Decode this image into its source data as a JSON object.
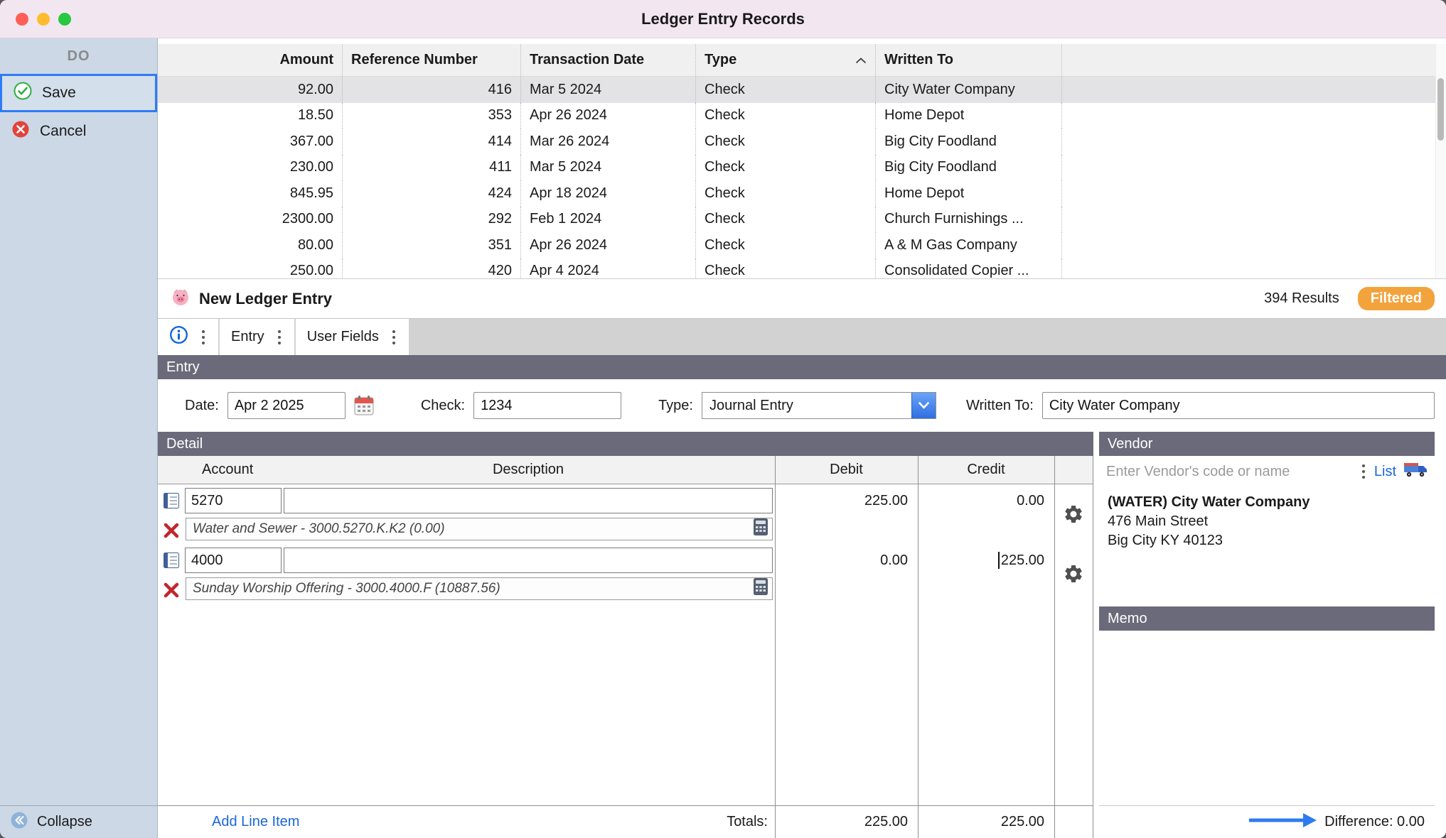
{
  "window": {
    "title": "Ledger Entry Records"
  },
  "sidebar": {
    "header": "DO",
    "save_label": "Save",
    "cancel_label": "Cancel",
    "collapse_label": "Collapse"
  },
  "records": {
    "columns": [
      "Amount",
      "Reference Number",
      "Transaction Date",
      "Type",
      "Written To"
    ],
    "sorted_by": "Type",
    "rows": [
      {
        "amount": "92.00",
        "reference": "416",
        "date": "Mar 5 2024",
        "type": "Check",
        "written_to": "City Water Company"
      },
      {
        "amount": "18.50",
        "reference": "353",
        "date": "Apr 26 2024",
        "type": "Check",
        "written_to": "Home Depot"
      },
      {
        "amount": "367.00",
        "reference": "414",
        "date": "Mar 26 2024",
        "type": "Check",
        "written_to": "Big City Foodland"
      },
      {
        "amount": "230.00",
        "reference": "411",
        "date": "Mar 5 2024",
        "type": "Check",
        "written_to": "Big City Foodland"
      },
      {
        "amount": "845.95",
        "reference": "424",
        "date": "Apr 18 2024",
        "type": "Check",
        "written_to": "Home Depot"
      },
      {
        "amount": "2300.00",
        "reference": "292",
        "date": "Feb 1 2024",
        "type": "Check",
        "written_to": "Church Furnishings ..."
      },
      {
        "amount": "80.00",
        "reference": "351",
        "date": "Apr 26 2024",
        "type": "Check",
        "written_to": "A & M Gas Company"
      },
      {
        "amount": "250.00",
        "reference": "420",
        "date": "Apr 4 2024",
        "type": "Check",
        "written_to": "Consolidated Copier ..."
      }
    ]
  },
  "entry_bar": {
    "title": "New Ledger Entry",
    "results": "394 Results",
    "filtered_label": "Filtered"
  },
  "tabs": {
    "entry": "Entry",
    "user_fields": "User Fields"
  },
  "entry": {
    "section_header": "Entry",
    "date_label": "Date:",
    "date_value": "Apr 2 2025",
    "check_label": "Check:",
    "check_value": "1234",
    "type_label": "Type:",
    "type_value": "Journal Entry",
    "written_to_label": "Written To:",
    "written_to_value": "City Water Company"
  },
  "detail": {
    "section_header": "Detail",
    "columns": [
      "Account",
      "Description",
      "Debit",
      "Credit"
    ],
    "lines": [
      {
        "account": "5270",
        "description": "",
        "debit": "225.00",
        "credit": "0.00",
        "account_info": "Water and Sewer - 3000.5270.K.K2 (0.00)"
      },
      {
        "account": "4000",
        "description": "",
        "debit": "0.00",
        "credit": "225.00",
        "account_info": "Sunday Worship Offering - 3000.4000.F (10887.56)"
      }
    ],
    "add_line_label": "Add Line Item",
    "totals_label": "Totals:",
    "total_debit": "225.00",
    "total_credit": "225.00"
  },
  "vendor": {
    "section_header": "Vendor",
    "search_placeholder": "Enter Vendor's code or name",
    "list_label": "List",
    "name": "(WATER) City Water Company",
    "address_line1": "476 Main Street",
    "address_line2": "Big City KY 40123",
    "memo_header": "Memo",
    "difference_label": "Difference: 0.00"
  },
  "icons": {
    "app": "pig-icon",
    "save": "green-check-circle-icon",
    "cancel": "red-x-circle-icon",
    "collapse": "double-chevron-left-icon",
    "info": "info-circle-icon",
    "calendar": "calendar-icon",
    "type_dropdown": "chevron-down-icon",
    "sort": "chevron-up-icon",
    "account_lookup": "ledger-book-icon",
    "delete_line": "red-x-icon",
    "budget": "calculator-icon",
    "line_settings": "gear-icon",
    "vendor_truck": "delivery-truck-icon",
    "menu": "vertical-dots-icon",
    "difference": "right-arrow-icon"
  },
  "colors": {
    "accent_blue": "#2e7bf6",
    "link_blue": "#1b66d6",
    "filtered_orange": "#f2a33c",
    "save_green": "#2fae43",
    "cancel_red": "#e1443c",
    "section_header_slate": "#6a6a7a",
    "sidebar_bg": "#ccd8e5",
    "titlebar_bg": "#f2e7f1"
  }
}
